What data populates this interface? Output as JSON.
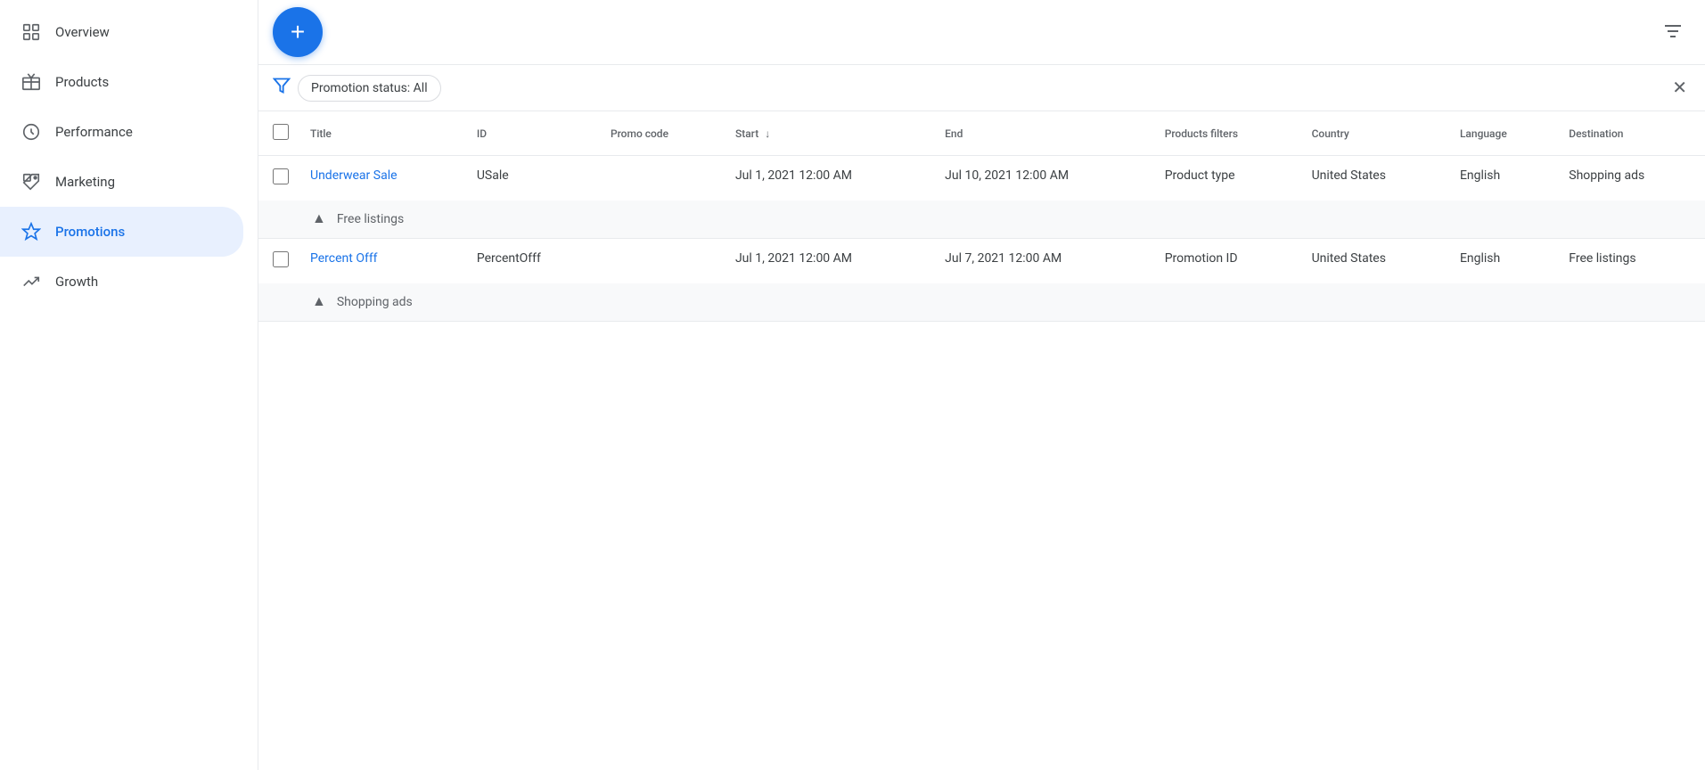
{
  "sidebar": {
    "items": [
      {
        "id": "overview",
        "label": "Overview",
        "icon": "grid-icon",
        "active": false
      },
      {
        "id": "products",
        "label": "Products",
        "icon": "box-icon",
        "active": false
      },
      {
        "id": "performance",
        "label": "Performance",
        "icon": "circle-icon",
        "active": false
      },
      {
        "id": "marketing",
        "label": "Marketing",
        "icon": "tag-icon",
        "active": false
      },
      {
        "id": "promotions",
        "label": "Promotions",
        "icon": "promo-icon",
        "active": true
      },
      {
        "id": "growth",
        "label": "Growth",
        "icon": "growth-icon",
        "active": false
      }
    ]
  },
  "topbar": {
    "fab_label": "+",
    "filter_icon_label": "≡"
  },
  "filter_bar": {
    "filter_chip_label": "Promotion status: All",
    "close_label": "✕"
  },
  "table": {
    "columns": [
      {
        "id": "select",
        "label": ""
      },
      {
        "id": "title",
        "label": "Title"
      },
      {
        "id": "id",
        "label": "ID"
      },
      {
        "id": "promo_code",
        "label": "Promo code"
      },
      {
        "id": "start",
        "label": "Start",
        "sortable": true
      },
      {
        "id": "end",
        "label": "End"
      },
      {
        "id": "products_filters",
        "label": "Products filters"
      },
      {
        "id": "country",
        "label": "Country"
      },
      {
        "id": "language",
        "label": "Language"
      },
      {
        "id": "destination",
        "label": "Destination"
      }
    ],
    "rows": [
      {
        "id": "row1",
        "title": "Underwear Sale",
        "promo_id": "USale",
        "promo_code": "",
        "start": "Jul 1, 2021 12:00 AM",
        "end": "Jul 10, 2021 12:00 AM",
        "products_filters": "Product type",
        "country": "United States",
        "language": "English",
        "destination": "Shopping ads",
        "expanded": true,
        "expansion_label": "Free listings",
        "expansion_chevron": "▲"
      },
      {
        "id": "row2",
        "title": "Percent Offf",
        "promo_id": "PercentOfff",
        "promo_code": "",
        "start": "Jul 1, 2021 12:00 AM",
        "end": "Jul 7, 2021 12:00 AM",
        "products_filters": "Promotion ID",
        "country": "United States",
        "language": "English",
        "destination": "Free listings",
        "expanded": true,
        "expansion_label": "Shopping ads",
        "expansion_chevron": "▲"
      }
    ],
    "sort_indicator": "↓"
  }
}
